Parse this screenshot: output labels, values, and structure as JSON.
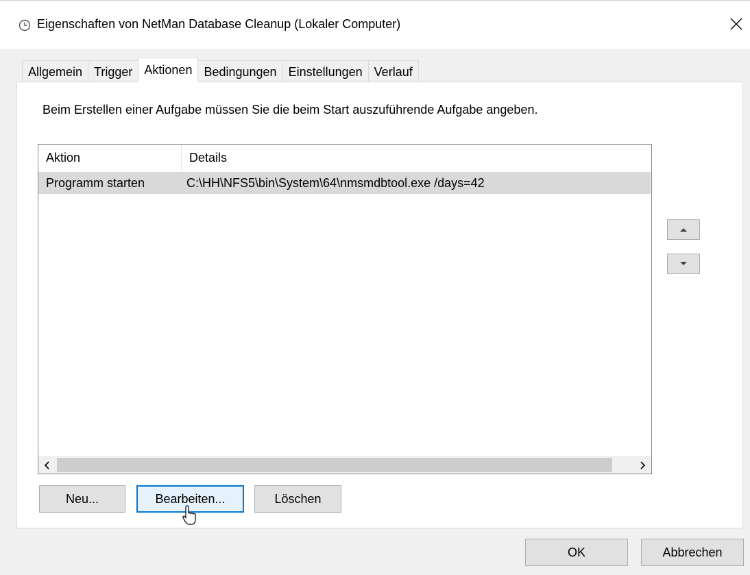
{
  "window": {
    "title": "Eigenschaften von NetMan Database Cleanup (Lokaler Computer)",
    "icon": "clock-icon",
    "close_symbol": "✕"
  },
  "tabs": [
    {
      "label": "Allgemein",
      "active": false
    },
    {
      "label": "Trigger",
      "active": false
    },
    {
      "label": "Aktionen",
      "active": true
    },
    {
      "label": "Bedingungen",
      "active": false
    },
    {
      "label": "Einstellungen",
      "active": false
    },
    {
      "label": "Verlauf",
      "active": false
    }
  ],
  "panel": {
    "instruction": "Beim Erstellen einer Aufgabe müssen Sie die beim Start auszuführende Aufgabe angeben."
  },
  "listview": {
    "columns": [
      "Aktion",
      "Details"
    ],
    "rows": [
      {
        "aktion": "Programm starten",
        "details": "C:\\HH\\NFS5\\bin\\System\\64\\nmsmdbtool.exe /days=42",
        "selected": true
      }
    ]
  },
  "action_buttons": {
    "new": "Neu...",
    "edit": "Bearbeiten...",
    "delete": "Löschen"
  },
  "dialog_buttons": {
    "ok": "OK",
    "cancel": "Abbrechen"
  },
  "colors": {
    "focus_accent": "#0078d7",
    "selection": "#d9d9d9"
  }
}
